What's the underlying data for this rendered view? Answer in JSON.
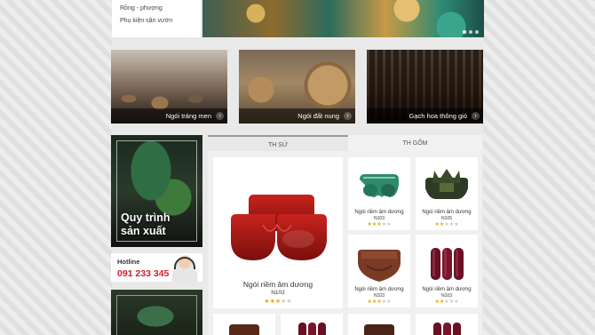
{
  "top_menu": {
    "items": [
      "Rồng - phượng",
      "Phụ kiện sân vườn"
    ]
  },
  "categories": [
    {
      "label": "Ngói tráng men"
    },
    {
      "label": "Ngói đất nung"
    },
    {
      "label": "Gạch hoa thông gió"
    }
  ],
  "sidebar": {
    "process_title_line1": "Quy trình",
    "process_title_line2": "sản xuất",
    "hotline_label": "Hotline",
    "hotline_number": "091 233 345"
  },
  "tabs": [
    {
      "label": "TH SỨ"
    },
    {
      "label": "TH GỐM"
    }
  ],
  "featured": {
    "name": "Ngói riềm âm dương",
    "code": "N102",
    "rating": 3
  },
  "products": [
    {
      "name": "Ngói riềm âm dương",
      "code": "N103",
      "rating": 3
    },
    {
      "name": "Ngói riềm âm dương",
      "code": "N105",
      "rating": 2
    },
    {
      "name": "Ngói riềm âm dương",
      "code": "N103",
      "rating": 3
    },
    {
      "name": "Ngói riềm âm dương",
      "code": "N103",
      "rating": 2
    }
  ],
  "colors": {
    "hotline_red": "#d0202f",
    "star_on": "#f2a60c",
    "star_off": "#c9c9c9"
  }
}
